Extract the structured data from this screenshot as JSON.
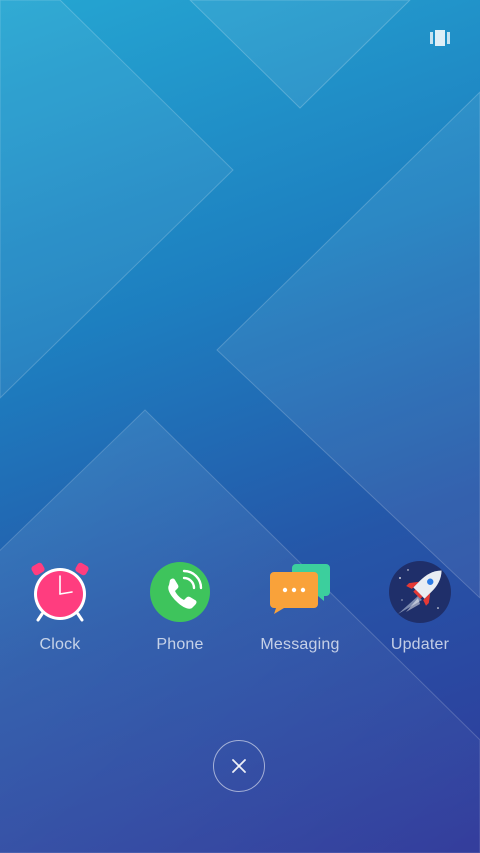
{
  "apps": [
    {
      "label": "Clock",
      "icon": "alarm-clock-icon"
    },
    {
      "label": "Phone",
      "icon": "phone-icon"
    },
    {
      "label": "Messaging",
      "icon": "chat-bubbles-icon"
    },
    {
      "label": "Updater",
      "icon": "rocket-icon"
    }
  ],
  "icons": {
    "top_right": "multi-window-icon",
    "close": "close-icon"
  },
  "colors": {
    "clock": "#ff3d7f",
    "phone": "#3ec45c",
    "messaging_front": "#f9a23a",
    "messaging_back": "#3ccf9d",
    "updater_bg": "#1f2f6a"
  }
}
